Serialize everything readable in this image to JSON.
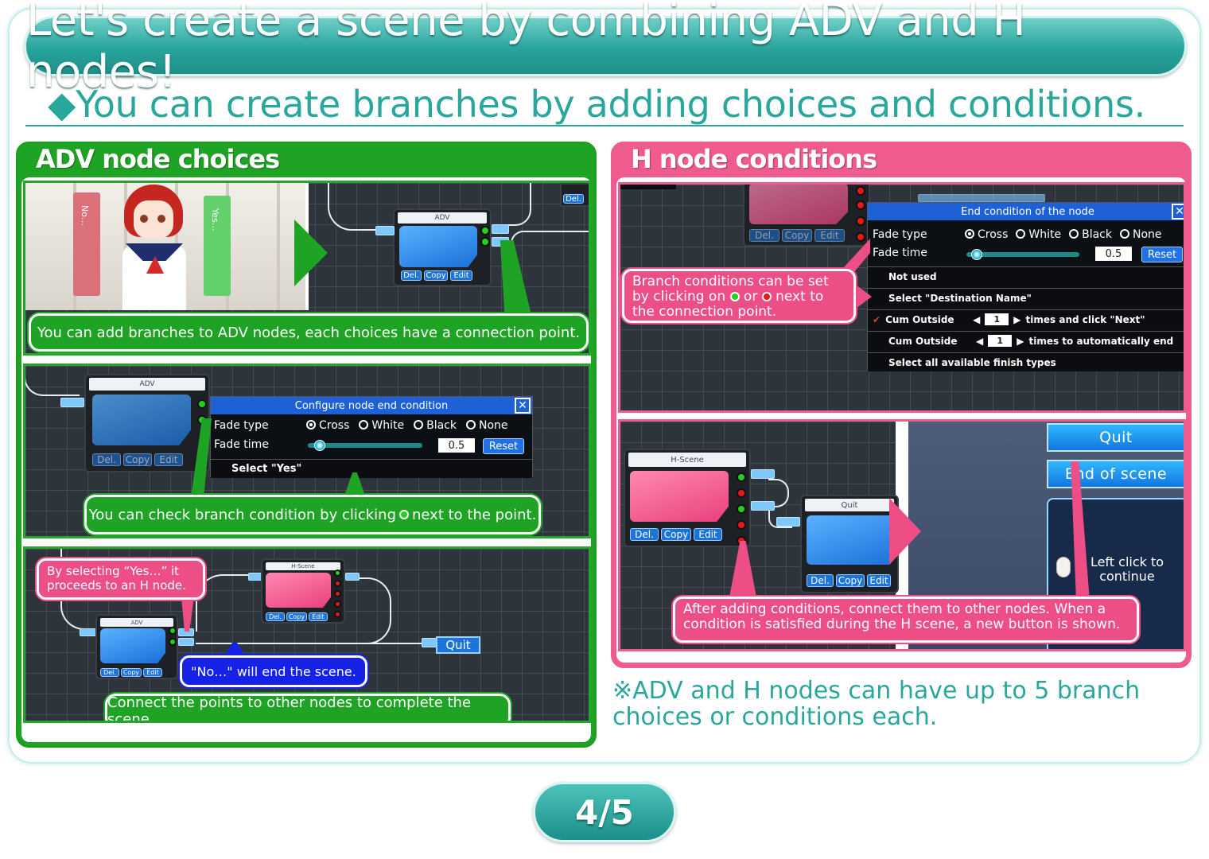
{
  "header": {
    "title": "Let's create a scene by combining ADV and H nodes!",
    "subtitle": "◆You can create branches by adding choices and conditions."
  },
  "left_panel": {
    "title": "ADV node choices",
    "shot1": {
      "choice_no": "No…",
      "choice_yes": "Yes…",
      "node_label": "ADV",
      "callout": "You can add branches to ADV nodes, each choices have a connection point."
    },
    "shot2": {
      "node_label": "ADV",
      "dialog_title": "Configure node end condition",
      "fade_type_label": "Fade type",
      "fade_options": [
        "Cross",
        "White",
        "Black",
        "None"
      ],
      "fade_time_label": "Fade time",
      "fade_time_value": "0.5",
      "reset": "Reset",
      "select_row": "Select \"Yes\"",
      "callout_before": "You can check branch condition by clicking",
      "callout_after": "next to the point."
    },
    "shot3": {
      "callout_yes": "By selecting “Yes…” it proceeds to an H node.",
      "callout_no": "\"No…\" will end the scene.",
      "callout_connect": "Connect the points to other nodes to complete the scene.",
      "adv_label": "ADV",
      "hscene_label": "H-Scene",
      "quit_label": "Quit"
    }
  },
  "right_panel": {
    "title": "H node conditions",
    "shot1": {
      "dialog_title": "End condition of the node",
      "fade_type_label": "Fade type",
      "fade_options": [
        "Cross",
        "White",
        "Black",
        "None"
      ],
      "fade_time_label": "Fade time",
      "fade_time_value": "0.5",
      "reset": "Reset",
      "rows": [
        "Not used",
        "Select \"Destination Name\""
      ],
      "cum_row1_label": "Cum Outside",
      "cum_row1_value": "1",
      "cum_row1_suffix": "times and click \"Next\"",
      "cum_row2_label": "Cum Outside",
      "cum_row2_value": "1",
      "cum_row2_suffix": "times to automatically end",
      "last_row": "Select all available finish types",
      "callout_1": "Branch conditions can be set by clicking on",
      "callout_or": "or",
      "callout_2": "next to the connection point."
    },
    "shot2": {
      "hscene_label": "H-Scene",
      "quit_label": "Quit",
      "btn_quit": "Quit",
      "btn_end": "End of scene",
      "continue_text": "Left click to continue",
      "callout": "After adding conditions, connect them to other nodes. When a condition is satisfied during the H scene, a new button is shown."
    }
  },
  "node_buttons": [
    "Del.",
    "Copy",
    "Edit"
  ],
  "footnote": "※ADV and H nodes can have up to 5 branch choices or conditions each.",
  "pager": "4/5",
  "colors": {
    "teal": "#2aa79c",
    "green": "#1fa325",
    "pink": "#ee5c8f",
    "blue": "#1622e8"
  }
}
